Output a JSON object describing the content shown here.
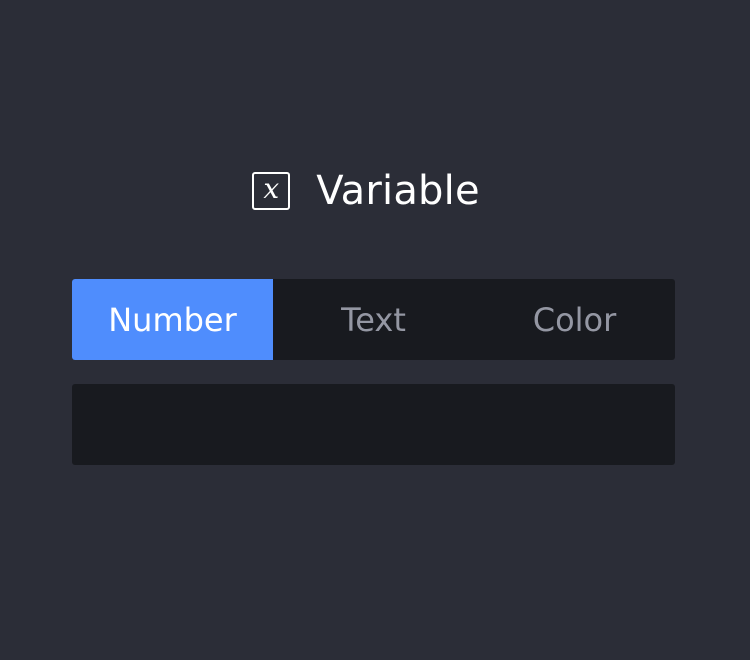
{
  "header": {
    "icon": "variable-x-icon",
    "icon_glyph": "x",
    "title": "Variable"
  },
  "tabs": [
    {
      "label": "Number",
      "active": true
    },
    {
      "label": "Text",
      "active": false
    },
    {
      "label": "Color",
      "active": false
    }
  ],
  "value_field": {
    "value": "",
    "placeholder": ""
  },
  "colors": {
    "background": "#2b2d37",
    "panel": "#181a1f",
    "accent": "#4f8dfd",
    "inactive_text": "#9497a3"
  }
}
